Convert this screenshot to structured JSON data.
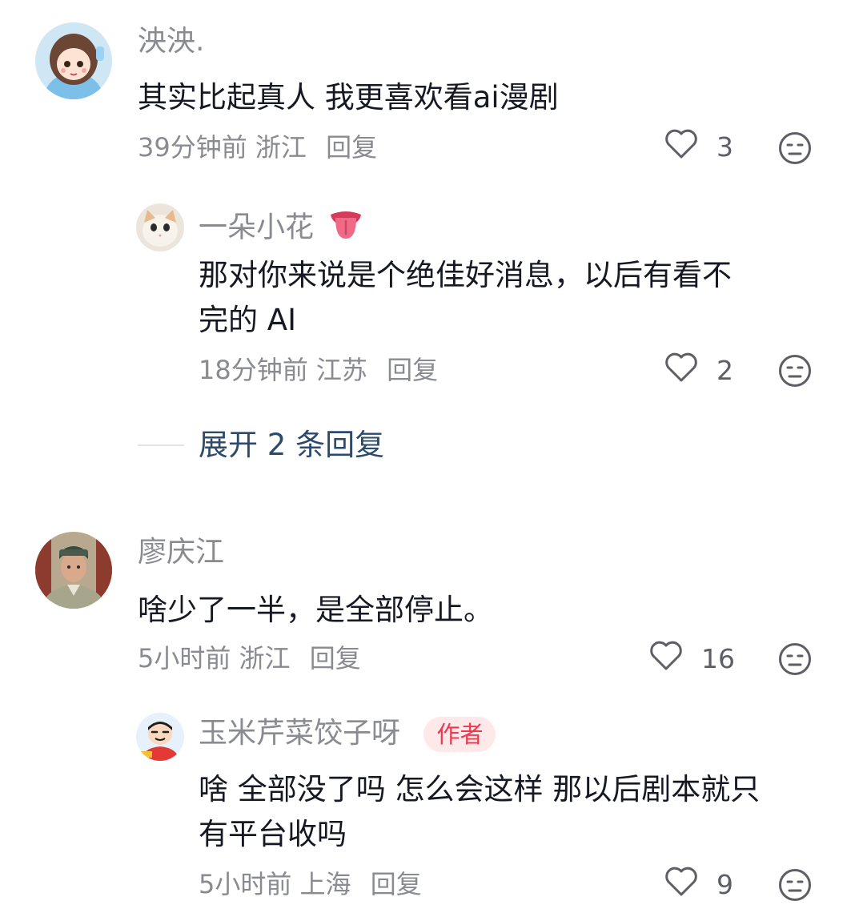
{
  "comments": [
    {
      "username": "泱泱.",
      "text": "其实比起真人 我更喜欢看ai漫剧",
      "time": "39分钟前",
      "location": "浙江",
      "reply_label": "回复",
      "likes": "3",
      "replies": [
        {
          "username": "一朵小花",
          "username_emoji": "tongue-emoji",
          "text_line1": "那对你来说是个绝佳好消息，以后有看不",
          "text_line2": "完的 AI",
          "time": "18分钟前",
          "location": "江苏",
          "reply_label": "回复",
          "likes": "2"
        }
      ],
      "expand_label": "展开 2 条回复"
    },
    {
      "username": "廖庆江",
      "text": "啥少了一半，是全部停止。",
      "time": "5小时前",
      "location": "浙江",
      "reply_label": "回复",
      "likes": "16",
      "replies": [
        {
          "username": "玉米芹菜饺子呀",
          "badge": "作者",
          "text_line1": "啥 全部没了吗 怎么会这样 那以后剧本就只",
          "text_line2": "有平台收吗",
          "time": "5小时前",
          "location": "上海",
          "reply_label": "回复",
          "likes": "9"
        }
      ]
    }
  ],
  "icons": {
    "like": "heart-outline-icon",
    "dislike": "meh-face-icon"
  },
  "colors": {
    "text": "#161823",
    "secondary": "#8a8b91",
    "expand_link": "#2c4a6b",
    "author_badge_bg": "#fde8ea",
    "author_badge_text": "#f0374d"
  }
}
